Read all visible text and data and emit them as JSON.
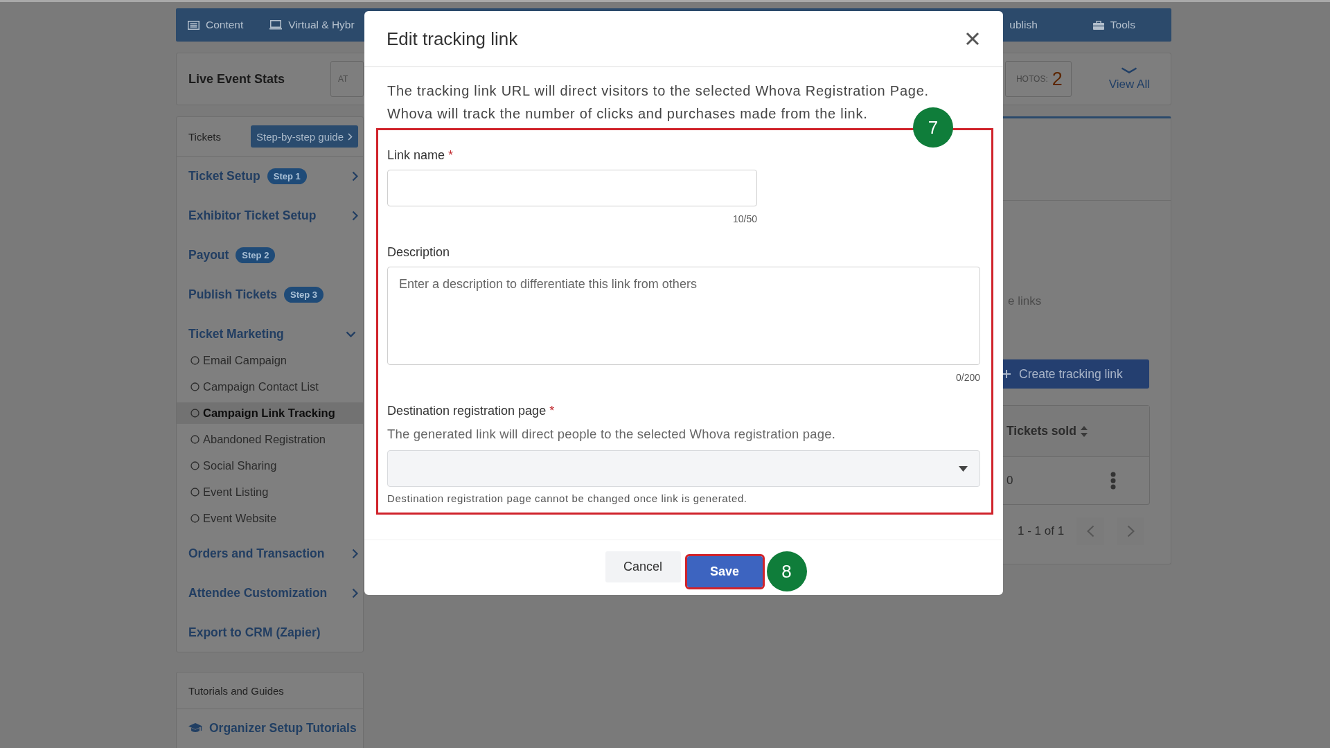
{
  "top_nav": [
    {
      "label": "Content"
    },
    {
      "label": "Virtual & Hybr"
    },
    {
      "label": "ublish"
    },
    {
      "label": "Tools"
    }
  ],
  "stats_bar": {
    "title": "Live Event Stats",
    "field_text": "AT",
    "photos_label": "HOTOS:",
    "photos_count": "2",
    "view_all": "View All"
  },
  "sidebar": {
    "header": "Tickets",
    "guide_button": "Step-by-step guide",
    "items": [
      {
        "label": "Ticket Setup",
        "badge": "Step 1",
        "expanded": false
      },
      {
        "label": "Exhibitor Ticket Setup",
        "expanded": false
      },
      {
        "label": "Payout",
        "badge": "Step 2"
      },
      {
        "label": "Publish Tickets",
        "badge": "Step 3"
      },
      {
        "label": "Ticket Marketing",
        "expanded": true,
        "children": [
          {
            "label": "Email Campaign",
            "selected": false
          },
          {
            "label": "Campaign Contact List",
            "selected": false
          },
          {
            "label": "Campaign Link Tracking",
            "selected": true
          },
          {
            "label": "Abandoned Registration",
            "selected": false
          },
          {
            "label": "Social Sharing",
            "selected": false
          },
          {
            "label": "Event Listing",
            "selected": false
          },
          {
            "label": "Event Website",
            "selected": false
          }
        ]
      },
      {
        "label": "Orders and Transaction",
        "expanded": false
      },
      {
        "label": "Attendee Customization",
        "expanded": false
      },
      {
        "label": "Export to CRM (Zapier)"
      }
    ]
  },
  "tutorials": {
    "header": "Tutorials and Guides",
    "link": "Organizer Setup Tutorials"
  },
  "main_panel": {
    "text_fragment": "e links",
    "create_button": "Create tracking link",
    "table": {
      "columns": [
        "Tickets sold"
      ],
      "rows": [
        [
          "0"
        ]
      ]
    },
    "pagination": "1 - 1 of 1"
  },
  "modal": {
    "title": "Edit tracking link",
    "intro": "The tracking link URL will direct visitors to the selected Whova Registration Page. Whova will track the number of clicks and purchases made from the link.",
    "highlight_frame": {
      "marker": "7"
    },
    "fields": [
      {
        "kind": "text",
        "label": "Link name",
        "required_mark": "*",
        "counter": "10/50"
      },
      {
        "kind": "textarea",
        "label": "Description",
        "placeholder": "Enter a description to differentiate this link from others",
        "counter": "0/200"
      },
      {
        "kind": "select",
        "label": "Destination registration page",
        "required_mark": "*",
        "help": "The generated link will direct people to the selected Whova registration page.",
        "note": "Destination registration page cannot be changed once link is generated."
      }
    ],
    "buttons": [
      {
        "label": "Cancel",
        "kind": "secondary",
        "highlighted": false
      },
      {
        "label": "Save",
        "kind": "primary",
        "highlighted": true,
        "marker": "8"
      }
    ]
  }
}
